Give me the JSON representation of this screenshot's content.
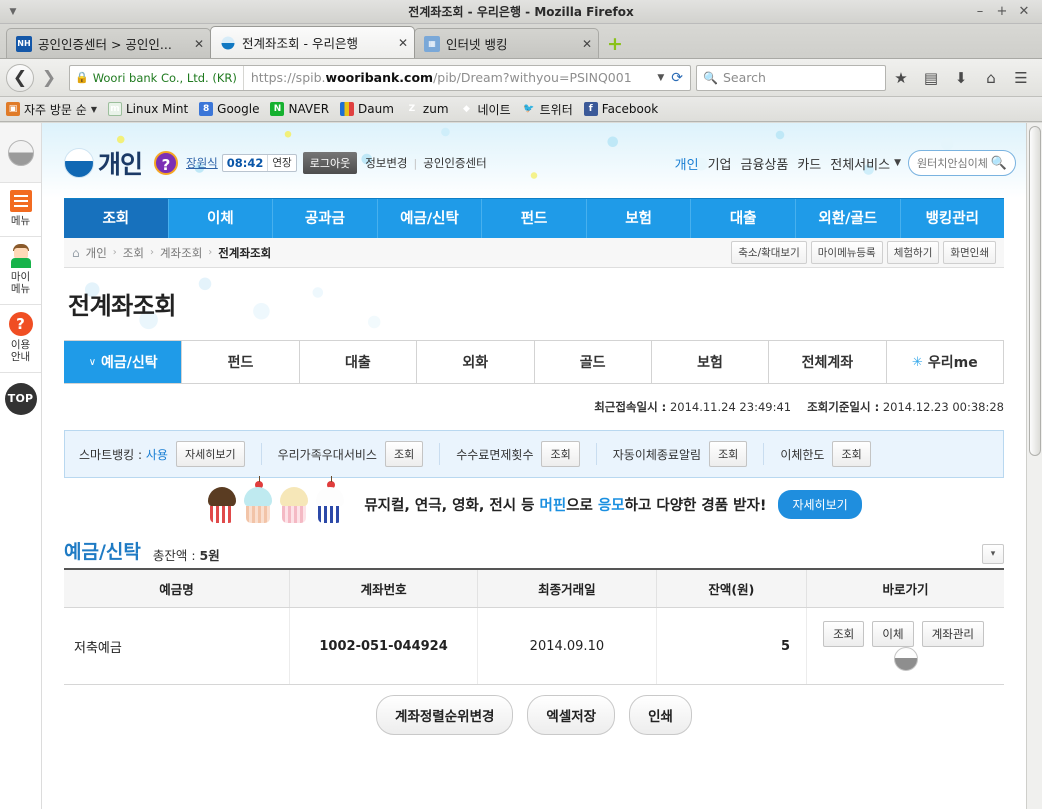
{
  "browser": {
    "window_title": "전계좌조회 - 우리은행 - Mozilla Firefox",
    "window_controls": {
      "minimize": "–",
      "maximize": "+",
      "close": "✕"
    },
    "menu_caret": "▼",
    "tabs": [
      {
        "title": "공인인증센터 > 공인인...",
        "favicon": "nh-favicon",
        "close": "✕",
        "active": false
      },
      {
        "title": "전계좌조회 - 우리은행",
        "favicon": "woori-favicon",
        "close": "✕",
        "active": true
      },
      {
        "title": "인터넷 뱅킹",
        "favicon": "internet-banking-favicon",
        "close": "✕",
        "active": false
      }
    ],
    "new_tab_label": "+",
    "nav": {
      "back": "❮",
      "forward": "❯",
      "home": "home-icon",
      "menu": "hamburger-icon",
      "download": "download-icon",
      "reader": "reader-icon",
      "bookmark_star": "★"
    },
    "urlbar": {
      "identity": "Woori bank Co., Ltd. (KR)",
      "lock": "lock-icon",
      "url_prefix": "https://spib.",
      "url_domain": "wooribank.com",
      "url_suffix": "/pib/Dream?withyou=PSINQ001",
      "dropdown_caret": "▼",
      "reload": "⟳"
    },
    "search": {
      "placeholder": "Search",
      "icon": "search-icon"
    },
    "bookmarks": [
      {
        "label": "자주 방문 순",
        "icon": "most-visited-icon",
        "caret": "▼"
      },
      {
        "label": "Linux Mint",
        "icon": "linux-mint-icon"
      },
      {
        "label": "Google",
        "icon": "google-icon"
      },
      {
        "label": "NAVER",
        "icon": "naver-icon"
      },
      {
        "label": "Daum",
        "icon": "daum-icon"
      },
      {
        "label": "zum",
        "icon": "zum-icon"
      },
      {
        "label": "네이트",
        "icon": "nate-icon"
      },
      {
        "label": "트위터",
        "icon": "twitter-icon"
      },
      {
        "label": "Facebook",
        "icon": "facebook-icon"
      }
    ]
  },
  "quickbar": {
    "logo": "woori-logo-icon",
    "items": [
      {
        "label": "메뉴",
        "icon": "list-menu-icon"
      },
      {
        "label": "마이\n메뉴",
        "label_line1": "마이",
        "label_line2": "메뉴",
        "icon": "person-icon"
      },
      {
        "label": "이용\n안내",
        "label_line1": "이용",
        "label_line2": "안내",
        "icon": "question-icon"
      }
    ],
    "top_button": "TOP"
  },
  "header": {
    "brand": "개인",
    "brand_logo": "woori-logo-icon",
    "help_badge": "?",
    "user_name": "장원식",
    "session_timer": "08:42",
    "extend_label": "연장",
    "logout_label": "로그아웃",
    "links": [
      "정보변경",
      "공인인증센터"
    ],
    "gnb_links": [
      "개인",
      "기업",
      "금융상품",
      "카드",
      "전체서비스"
    ],
    "gnb_caret": "▼",
    "search_placeholder": "원터치안심이체",
    "search_icon": "search-icon"
  },
  "main_nav": {
    "items": [
      "조회",
      "이체",
      "공과금",
      "예금/신탁",
      "펀드",
      "보험",
      "대출",
      "외환/골드",
      "뱅킹관리"
    ],
    "active_index": 0
  },
  "breadcrumb": {
    "home_icon": "home-icon",
    "items": [
      "개인",
      "조회",
      "계좌조회",
      "전계좌조회"
    ],
    "separator": "›",
    "actions": [
      "축소/확대보기",
      "마이메뉴등록",
      "체험하기",
      "화면인쇄"
    ]
  },
  "page": {
    "title": "전계좌조회"
  },
  "sub_tabs": {
    "items": [
      {
        "label": "예금/신탁",
        "chevron": "∨",
        "active": true
      },
      {
        "label": "펀드",
        "active": false
      },
      {
        "label": "대출",
        "active": false
      },
      {
        "label": "외화",
        "active": false
      },
      {
        "label": "골드",
        "active": false
      },
      {
        "label": "보험",
        "active": false
      },
      {
        "label": "전체계좌",
        "active": false
      },
      {
        "label": "우리me",
        "star": "✳",
        "active": false
      }
    ]
  },
  "meta": {
    "last_access_label": "최근접속일시 :",
    "last_access_value": "2014.11.24 23:49:41",
    "query_base_label": "조회기준일시 :",
    "query_base_value": "2014.12.23 00:38:28"
  },
  "info_strip": {
    "cells": [
      {
        "label_prefix": "스마트뱅킹 : ",
        "label_value": "사용",
        "button": "자세히보기"
      },
      {
        "label_prefix": "우리가족우대서비스",
        "label_value": "",
        "button": "조회"
      },
      {
        "label_prefix": "수수료면제횟수",
        "label_value": "",
        "button": "조회"
      },
      {
        "label_prefix": "자동이체종료알림",
        "label_value": "",
        "button": "조회"
      },
      {
        "label_prefix": "이체한도",
        "label_value": "",
        "button": "조회"
      }
    ]
  },
  "banner": {
    "icon": "cupcakes-icon",
    "text_part1": "뮤지컬, 연극, 영화, 전시 등 ",
    "highlight1": "머핀",
    "text_part2": "으로 ",
    "highlight2": "응모",
    "text_part3": "하고 다양한 경품 받자!",
    "cta": "자세히보기"
  },
  "account_section": {
    "title": "예금/신탁",
    "total_label": "총잔액 : ",
    "total_value": "5원",
    "toggle_icon": "chevron-down-icon",
    "columns": [
      "예금명",
      "계좌번호",
      "최종거래일",
      "잔액(원)",
      "바로가기"
    ],
    "rows": [
      {
        "name": "저축예금",
        "number": "1002-051-044924",
        "last_date": "2014.09.10",
        "balance": "5",
        "actions": [
          "조회",
          "이체",
          "계좌관리"
        ],
        "round_action": "woori-icon-button"
      }
    ]
  },
  "footer_actions": [
    "계좌정렬순위변경",
    "엑셀저장",
    "인쇄"
  ],
  "colors": {
    "brand_blue": "#1f9be8",
    "active_nav": "#1771bd",
    "link_blue": "#1a7fd4",
    "info_strip_bg": "#eaf4fd",
    "orange": "#f26b21"
  }
}
